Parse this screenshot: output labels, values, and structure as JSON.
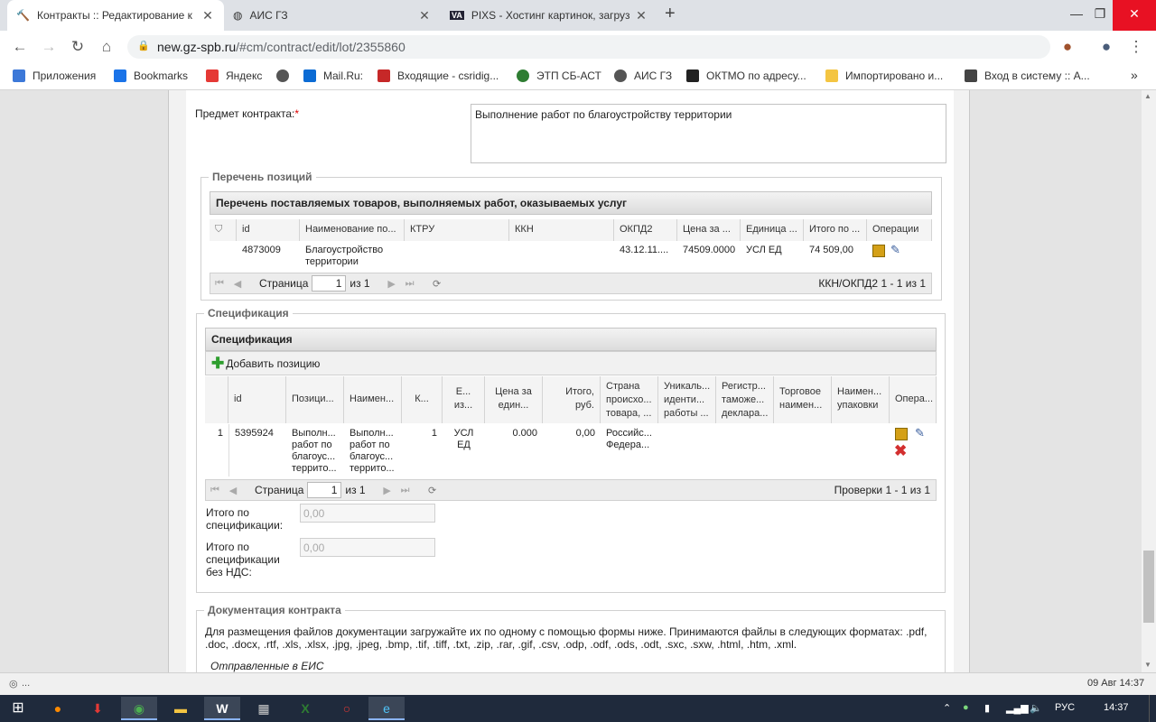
{
  "browser": {
    "tabs": [
      {
        "title": "Контракты :: Редактирование к"
      },
      {
        "title": "АИС ГЗ"
      },
      {
        "title": "PIXS - Хостинг картинок, загруз"
      }
    ],
    "url_host": "new.gz-spb.ru",
    "url_path": "/#cm/contract/edit/lot/2355860",
    "bookmarks": [
      "Приложения",
      "Bookmarks",
      "Яндекс",
      "Mail.Ru:",
      "Входящие - csridig...",
      "ЭТП СБ-АСТ",
      "АИС ГЗ",
      "ОКТМО по адресу...",
      "Импортировано и...",
      "Вход в систему :: А..."
    ],
    "bookmark_colors": [
      "#3c78d8",
      "#1a73e8",
      "#e53935",
      "#555555",
      "#0b6bd4",
      "#c62828",
      "#2e7d32",
      "#555555",
      "#222222",
      "#f4c542",
      "#444444"
    ]
  },
  "form": {
    "subject_label": "Предмет контракта:",
    "required_mark": "*",
    "subject_value": "Выполнение работ по благоустройству территории"
  },
  "positions": {
    "legend": "Перечень позиций",
    "grid_title": "Перечень поставляемых товаров, выполняемых работ, оказываемых услуг",
    "columns": [
      "id",
      "Наименование по...",
      "КТРУ",
      "ККН",
      "ОКПД2",
      "Цена за ...",
      "Единица ...",
      "Итого по ...",
      "Операции"
    ],
    "row": [
      "4873009",
      "Благоустройство территории",
      "",
      "",
      "43.12.11....",
      "74509.0000",
      "УСЛ ЕД",
      "74 509,00"
    ],
    "pager": {
      "page_label": "Страница",
      "page": "1",
      "of": "из 1",
      "summary": "ККН/ОКПД2 1 - 1 из 1"
    }
  },
  "spec": {
    "legend": "Спецификация",
    "grid_title": "Спецификация",
    "add_label": "Добавить позицию",
    "columns": [
      "id",
      "Позици...",
      "Наимен...",
      "К...",
      "Е... из...",
      "Цена за един...",
      "Итого, руб.",
      "Страна происхо... товара, ...",
      "Уникаль... иденти... работы ...",
      "Регистр... таможе... деклара...",
      "Торговое наимен...",
      "Наимен... упаковки",
      "Опера..."
    ],
    "row": [
      "1",
      "5395924",
      "Выполн... работ по благоус... террито...",
      "Выполн... работ по благоус... террито...",
      "1",
      "УСЛ ЕД",
      "0.000",
      "0,00",
      "Российс... Федера..."
    ],
    "pager": {
      "page_label": "Страница",
      "page": "1",
      "of": "из 1",
      "summary": "Проверки 1 - 1 из 1"
    },
    "total_label": "Итого по спецификации:",
    "total_value": "0,00",
    "total_novat_label": "Итого по спецификации без НДС:",
    "total_novat_value": "0,00"
  },
  "docs": {
    "legend": "Документация контракта",
    "text": "Для размещения файлов документации загружайте их по одному с помощью формы ниже. Принимаются файлы в следующих форматах: .pdf, .doc, .docx, .rtf, .xls, .xlsx, .jpg, .jpeg, .bmp, .tif, .tiff, .txt, .zip, .rar, .gif, .csv, .odp, .odf, .ods, .odt, .sxc, .sxw, .html, .htm, .xml.",
    "sent": "Отправленные в ЕИС"
  },
  "status": {
    "left": "...",
    "right": "09 Авг 14:37"
  },
  "taskbar": {
    "lang": "РУС",
    "time": "14:37"
  }
}
